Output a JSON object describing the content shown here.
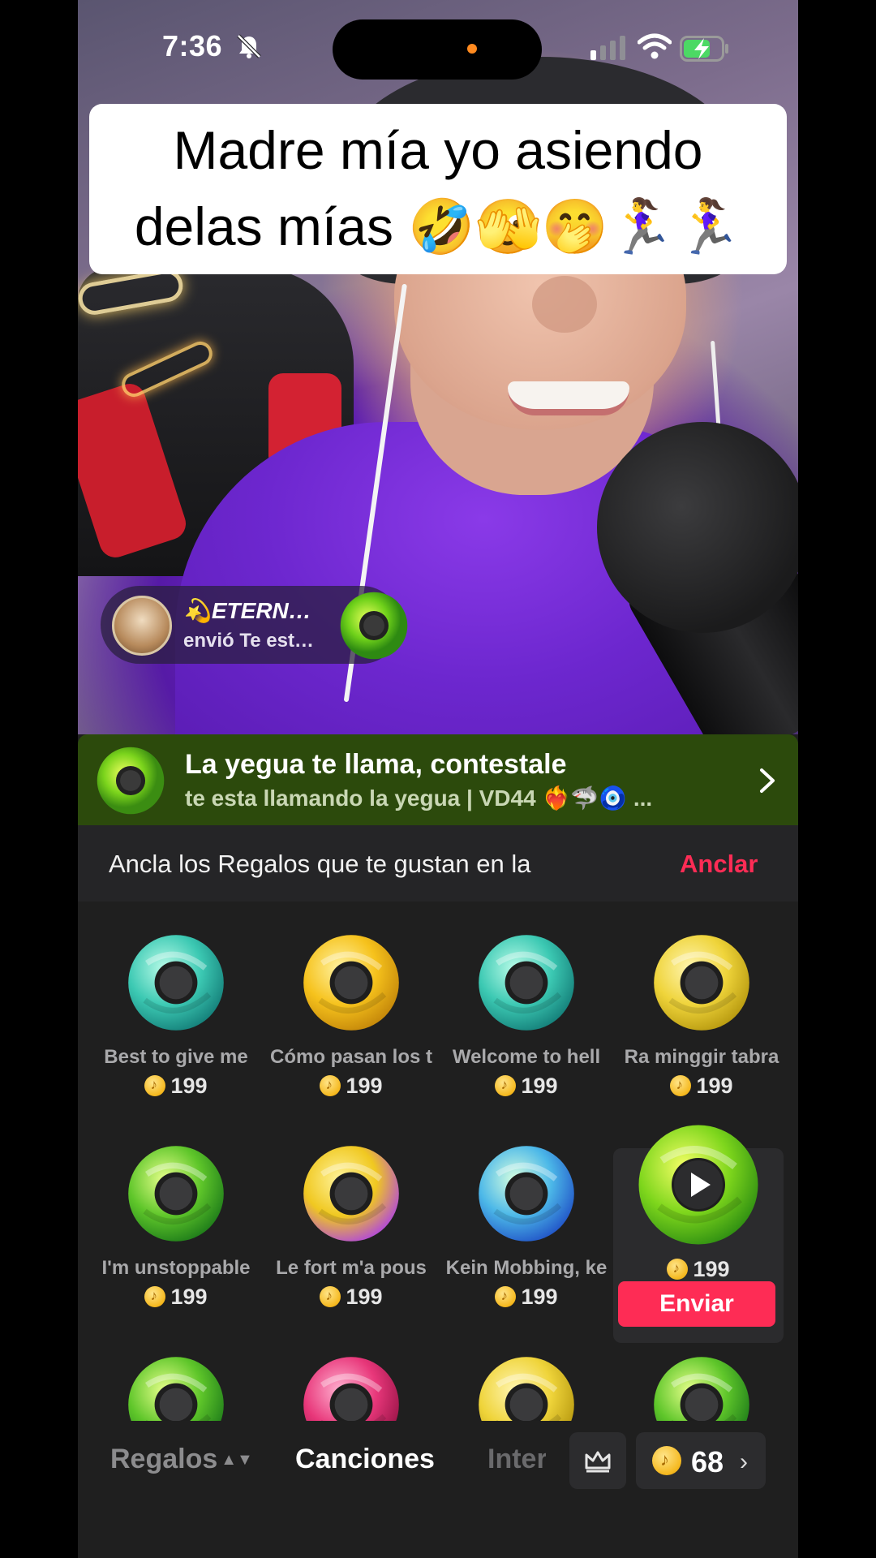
{
  "status_bar": {
    "time": "7:36"
  },
  "caption": {
    "line1": "Madre mía yo asiendo",
    "line2": "delas mías 🤣🫣🤭🏃‍♀️🏃‍♀️"
  },
  "gift_notification": {
    "sender": "💫ETERN…",
    "message": "envió Te est…"
  },
  "now_playing_banner": {
    "title": "La yegua te llama, contestale",
    "subtitle": "te esta llamando la yegua | VD44 ❤️‍🔥🦈🧿 ..."
  },
  "pin_row": {
    "text": "Ancla los Regalos que te gustan en la",
    "action": "Anclar"
  },
  "songs": [
    {
      "name": "Best to give me",
      "price": "199",
      "color": "teal"
    },
    {
      "name": "Cómo pasan los t",
      "price": "199",
      "color": "gold"
    },
    {
      "name": "Welcome to hell",
      "price": "199",
      "color": "teal"
    },
    {
      "name": "Ra minggir tabra",
      "price": "199",
      "color": "gold-photo"
    },
    {
      "name": "I'm unstoppable",
      "price": "199",
      "color": "green"
    },
    {
      "name": "Le fort m'a pous",
      "price": "199",
      "color": "gold-purple"
    },
    {
      "name": "Kein Mobbing, ke",
      "price": "199",
      "color": "blue"
    },
    {
      "name": "",
      "price": "199",
      "color": "lime",
      "selected": true,
      "send_label": "Enviar"
    },
    {
      "name": "",
      "price": "",
      "color": "green"
    },
    {
      "name": "",
      "price": "",
      "color": "pink"
    },
    {
      "name": "",
      "price": "",
      "color": "gold-photo"
    },
    {
      "name": "",
      "price": "",
      "color": "green"
    }
  ],
  "tabbar": {
    "regalos": "Regalos",
    "canciones": "Canciones",
    "inter": "Inter",
    "balance": "68"
  },
  "colors": {
    "accent": "#fe2c55",
    "banner_bg": "#2c4a0c",
    "panel_bg": "#1f1f1f"
  }
}
